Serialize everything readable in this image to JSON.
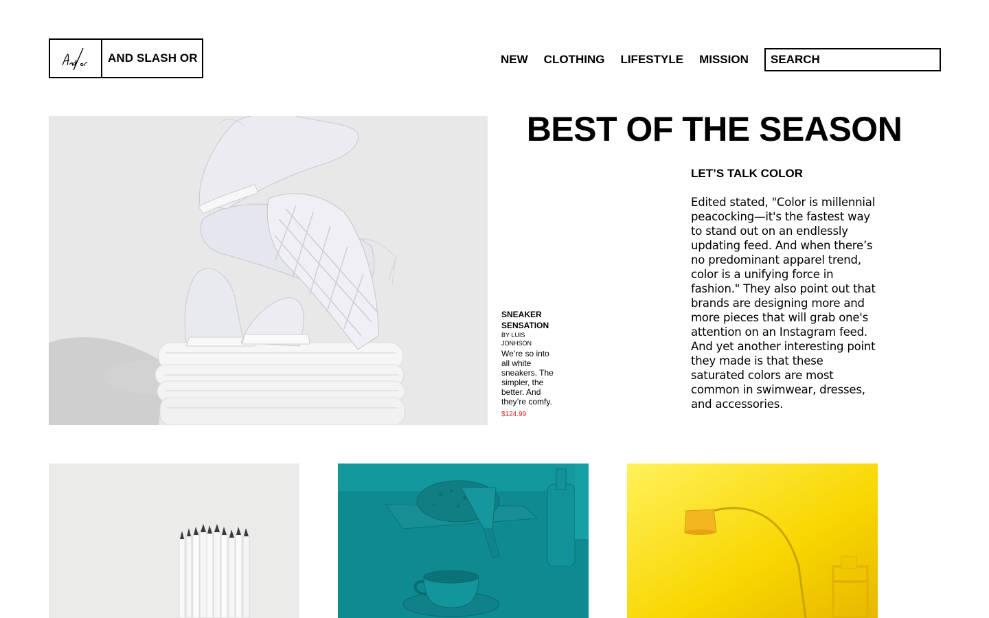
{
  "brand": {
    "name": "AND SLASH OR",
    "logo_mark_text": "And/or"
  },
  "nav": {
    "items": [
      {
        "label": "NEW"
      },
      {
        "label": "CLOTHING"
      },
      {
        "label": "LIFESTYLE"
      },
      {
        "label": "MISSION"
      }
    ]
  },
  "search": {
    "placeholder": "SEARCH"
  },
  "hero": {
    "title": "BEST OF THE SEASON",
    "image_alt": "white sneakers on folded towels"
  },
  "product": {
    "name": "SNEAKER SENSATION",
    "author": "BY LUIS JONHSON",
    "description": "We’re so into all white sneakers. The simpler, the better. And they’re comfy.",
    "price": "$124.99",
    "price_color": "#e31b1b"
  },
  "article": {
    "title": "LET’S TALK COLOR",
    "body": "Edited stated, \"Color is millennial peacocking—it's the fastest way to stand out on an endlessly updating feed. And when there’s no predominant apparel trend, color is a unifying force in fashion.\" They also point out that brands are designing more and more pieces that will grab one's attention on an Instagram feed. And yet another interesting point they made is that these saturated colors are most common in swimwear, dresses, and accessories."
  },
  "tiles": [
    {
      "image_alt": "white pencils",
      "color": "#ebebea"
    },
    {
      "image_alt": "teal bread, knife, cup and bottle",
      "color": "#0f8d93"
    },
    {
      "image_alt": "yellow arc floor lamp",
      "color": "#f7d700"
    }
  ]
}
